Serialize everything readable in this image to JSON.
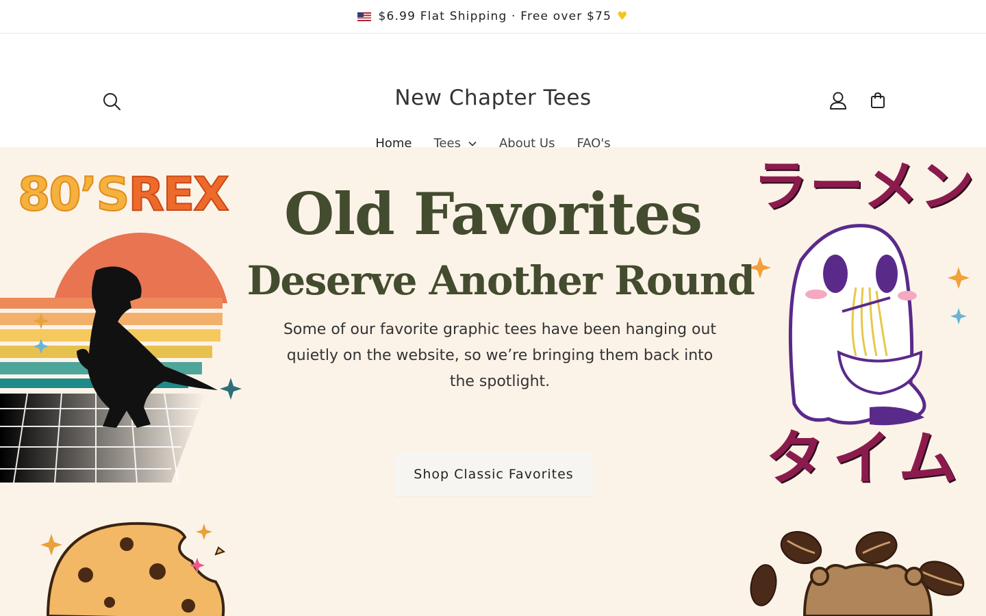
{
  "announcement": {
    "text": "$6.99 Flat Shipping · Free over $75",
    "flag_icon": "us-flag-icon",
    "heart_icon": "yellow-heart-icon"
  },
  "header": {
    "title": "New Chapter Tees",
    "search_icon": "search-icon",
    "account_icon": "account-icon",
    "cart_icon": "cart-icon"
  },
  "nav": {
    "items": [
      {
        "label": "Home",
        "active": true
      },
      {
        "label": "Tees",
        "has_dropdown": true
      },
      {
        "label": "About Us"
      },
      {
        "label": "FAQ's"
      }
    ]
  },
  "hero": {
    "headline": "Old Favorites",
    "subheadline": "Deserve Another Round",
    "body": "Some of our favorite graphic tees have been hanging out quietly on the website, so we’re bringing them back into the spotlight.",
    "cta_label": "Shop Classic Favorites",
    "background_color": "#fcf3e8",
    "headline_color": "#434c2e",
    "art": {
      "rex_text_a": "80’S",
      "rex_text_b": "REX",
      "ramen_text_top": "ラーメン",
      "ramen_text_bottom": "タイム"
    }
  }
}
